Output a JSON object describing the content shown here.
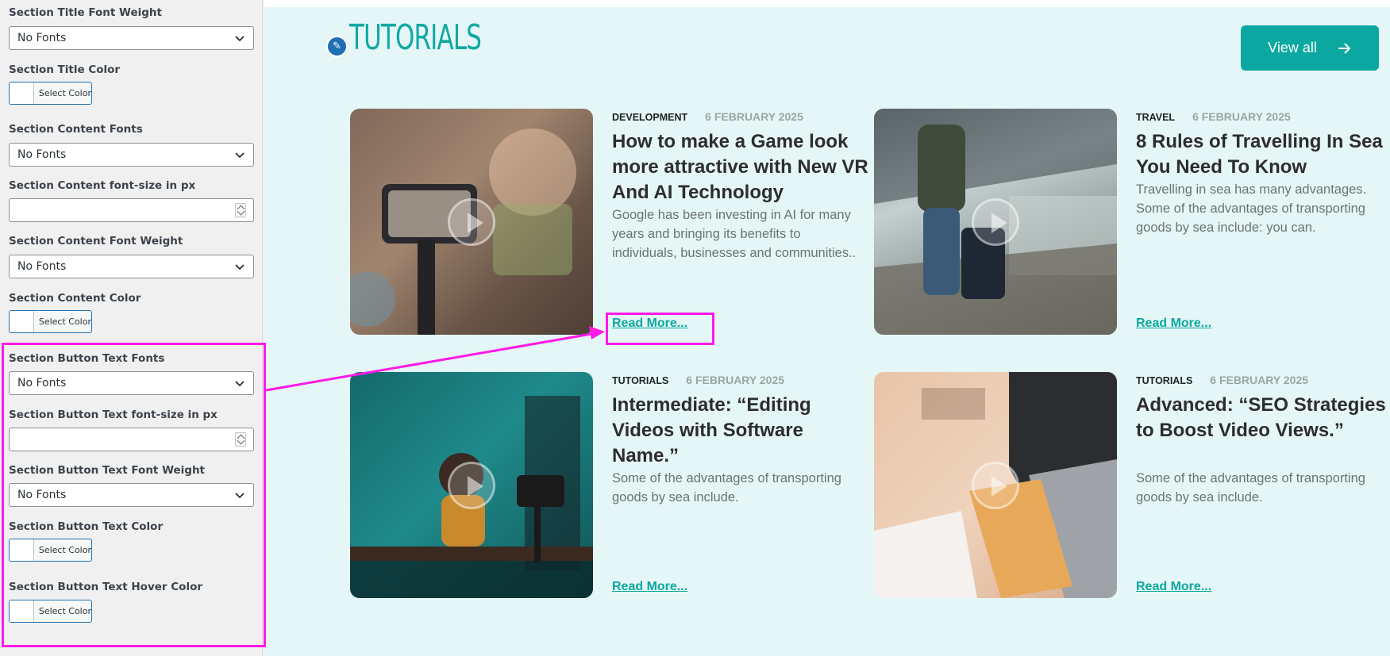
{
  "sidebar": {
    "fields": {
      "title_weight_label": "Section Title Font Weight",
      "title_weight_value": "No Fonts",
      "title_color_label": "Section Title Color",
      "content_fonts_label": "Section Content Fonts",
      "content_fonts_value": "No Fonts",
      "content_size_label": "Section Content font-size in px",
      "content_weight_label": "Section Content Font Weight",
      "content_weight_value": "No Fonts",
      "content_color_label": "Section Content Color",
      "button_fonts_label": "Section Button Text Fonts",
      "button_fonts_value": "No Fonts",
      "button_size_label": "Section Button Text font-size in px",
      "button_weight_label": "Section Button Text Font Weight",
      "button_weight_value": "No Fonts",
      "button_color_label": "Section Button Text Color",
      "button_hover_label": "Section Button Text Hover Color"
    },
    "select_color_label": "Select Color"
  },
  "preview": {
    "section_title": "TUTORIALS",
    "view_all_label": "View all",
    "read_more_label": "Read More...",
    "cards": [
      {
        "category": "DEVELOPMENT",
        "date": "6 FEBRUARY 2025",
        "title": "How to make a Game look more attractive with New VR And AI Technology",
        "excerpt": "Google has been investing in AI for many years and bringing its benefits to individuals, businesses and communities..",
        "image": "phone-gimbal-filming"
      },
      {
        "category": "TRAVEL",
        "date": "6 FEBRUARY 2025",
        "title": "8 Rules of Travelling In Sea You Need To Know",
        "excerpt": "Travelling in sea has many advantages. Some of the advantages of transporting goods by sea include: you can.",
        "image": "traveller-with-suitcase"
      },
      {
        "category": "TUTORIALS",
        "date": "6 FEBRUARY 2025",
        "title": "Intermediate: “Editing Videos with Software Name.”",
        "excerpt": "Some of the advantages of transporting goods by sea include.",
        "image": "video-editor-desk"
      },
      {
        "category": "TUTORIALS",
        "date": "6 FEBRUARY 2025",
        "title": "Advanced: “SEO Strategies to Boost Video Views.”",
        "excerpt": "Some of the advantages of transporting goods by sea include.",
        "image": "laptop-notebook-flatlay"
      }
    ]
  },
  "colors": {
    "accent": "#0aa8a0",
    "highlight": "#ff1ae8",
    "preview_bg": "#e5f6f6"
  }
}
